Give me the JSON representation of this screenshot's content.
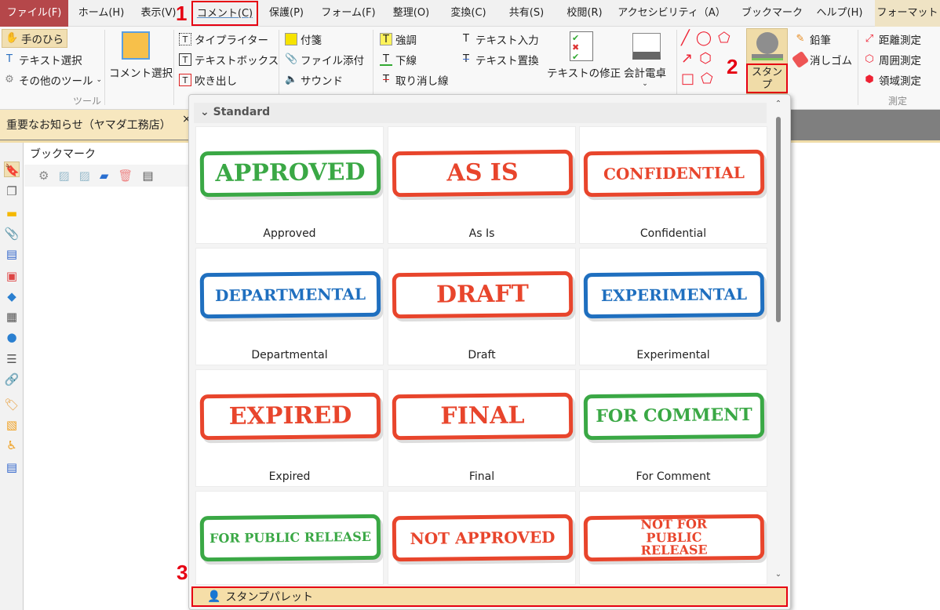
{
  "menu": {
    "tabs": [
      "ファイル(F)",
      "ホーム(H)",
      "表示(V)",
      "コメント(C)",
      "保護(P)",
      "フォーム(F)",
      "整理(O)",
      "変換(C)",
      "共有(S)",
      "校閲(R)",
      "アクセシビリティ（A）",
      "ブックマーク",
      "ヘルプ(H)",
      "フォーマット"
    ]
  },
  "ribbon": {
    "hand": "手のひら",
    "text_select": "テキスト選択",
    "other_tools": "その他のツール",
    "tools_group": "ツール",
    "comment_select": "コメント選択",
    "typewriter": "タイプライター",
    "textbox": "テキストボックス",
    "callout": "吹き出し",
    "note": "付箋",
    "file_attach": "ファイル添付",
    "sound": "サウンド",
    "highlight": "強調",
    "underline": "下線",
    "strikeout": "取り消し線",
    "text_insert": "テキスト入力",
    "text_replace": "テキスト置換",
    "text_fix": "テキストの修正",
    "calculator": "会計電卓",
    "stamp": "スタンプ",
    "pencil": "鉛筆",
    "eraser": "消しゴム",
    "distance": "距離測定",
    "perimeter": "周囲測定",
    "area": "領域測定",
    "measure_group": "測定"
  },
  "annotations": [
    "1",
    "2",
    "3"
  ],
  "document_tab": {
    "title": "重要なお知らせ（ヤマダ工務店）",
    "close": "×"
  },
  "bookmark_panel": {
    "title": "ブックマーク"
  },
  "stamp_panel": {
    "section": "Standard",
    "footer": "スタンプパレット",
    "stamps": [
      {
        "text": "APPROVED",
        "label": "Approved",
        "color": "#3aa845"
      },
      {
        "text": "AS IS",
        "label": "As Is",
        "color": "#e8452c"
      },
      {
        "text": "CONFIDENTIAL",
        "label": "Confidential",
        "color": "#e8452c"
      },
      {
        "text": "DEPARTMENTAL",
        "label": "Departmental",
        "color": "#1f6fbf"
      },
      {
        "text": "DRAFT",
        "label": "Draft",
        "color": "#e8452c"
      },
      {
        "text": "EXPERIMENTAL",
        "label": "Experimental",
        "color": "#1f6fbf"
      },
      {
        "text": "EXPIRED",
        "label": "Expired",
        "color": "#e8452c"
      },
      {
        "text": "FINAL",
        "label": "Final",
        "color": "#e8452c"
      },
      {
        "text": "FOR COMMENT",
        "label": "For Comment",
        "color": "#3aa845"
      },
      {
        "text": "FOR PUBLIC RELEASE",
        "label": "",
        "color": "#3aa845"
      },
      {
        "text": "NOT APPROVED",
        "label": "",
        "color": "#e8452c"
      },
      {
        "text": "NOT FOR PUBLIC RELEASE",
        "label": "",
        "color": "#e8452c"
      }
    ]
  },
  "colors": {
    "accent_red": "#e60012",
    "file_tab": "#b5474a",
    "active_beige": "#f5dea8"
  }
}
